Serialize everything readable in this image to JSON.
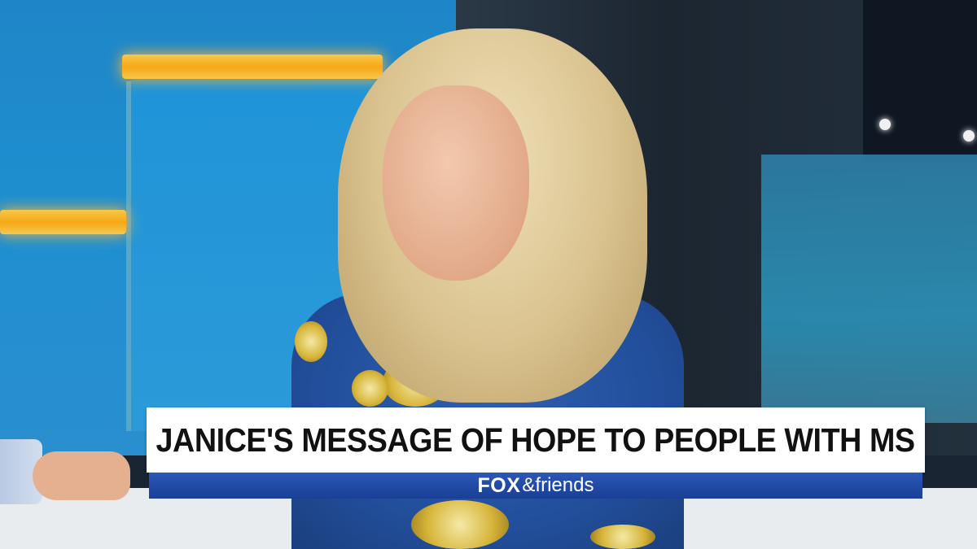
{
  "lower_third": {
    "headline": "JANICE'S MESSAGE OF HOPE TO PEOPLE WITH MS",
    "brand_fox": "FOX",
    "brand_friends": "&friends"
  }
}
